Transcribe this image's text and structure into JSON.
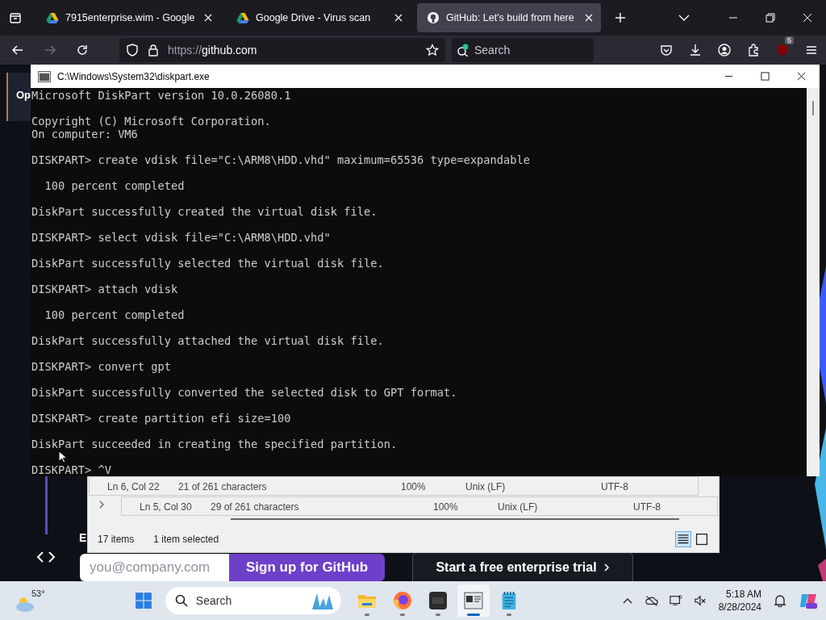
{
  "browser": {
    "tabs": [
      {
        "title": "7915enterprise.wim - Google",
        "kind": "drive",
        "selected": false
      },
      {
        "title": "Google Drive - Virus scan",
        "kind": "drive",
        "selected": false
      },
      {
        "title": "GitHub: Let's build from here",
        "kind": "github",
        "selected": true
      }
    ],
    "back_disabled": false,
    "forward_disabled": true,
    "url": {
      "scheme": "https://",
      "host": "github.com"
    },
    "search": {
      "placeholder": "Search"
    },
    "extension_badge": "5"
  },
  "console": {
    "title": "C:\\Windows\\System32\\diskpart.exe",
    "paragraphs": [
      [
        "Microsoft DiskPart version 10.0.26080.1"
      ],
      [
        "Copyright (C) Microsoft Corporation.",
        "On computer: VM6"
      ],
      [
        "DISKPART> create vdisk file=\"C:\\ARM8\\HDD.vhd\" maximum=65536 type=expandable"
      ],
      [
        "  100 percent completed"
      ],
      [
        "DiskPart successfully created the virtual disk file."
      ],
      [
        "DISKPART> select vdisk file=\"C:\\ARM8\\HDD.vhd\""
      ],
      [
        "DiskPart successfully selected the virtual disk file."
      ],
      [
        "DISKPART> attach vdisk"
      ],
      [
        "  100 percent completed"
      ],
      [
        "DiskPart successfully attached the virtual disk file."
      ],
      [
        "DISKPART> convert gpt"
      ],
      [
        "DiskPart successfully converted the selected disk to GPT format."
      ],
      [
        "DISKPART> create partition efi size=100"
      ],
      [
        "DiskPart succeeded in creating the specified partition."
      ],
      [
        "DISKPART> ^V"
      ]
    ]
  },
  "notepads": [
    {
      "position": "Ln 6, Col 22",
      "characters": "21 of 261 characters",
      "zoom": "100%",
      "line_ending": "Unix (LF)",
      "encoding": "UTF-8"
    },
    {
      "position": "Ln 5, Col 30",
      "characters": "29 of 261 characters",
      "zoom": "100%",
      "line_ending": "Unix (LF)",
      "encoding": "UTF-8"
    }
  ],
  "explorer": {
    "item_count": "17 items",
    "selection": "1 item selected"
  },
  "page": {
    "card_texts": [
      "Op"
    ],
    "side_letter": "E",
    "email_placeholder": "you@company.com",
    "signup_button": "Sign up for GitHub",
    "enterprise_button": "Start a free enterprise trial"
  },
  "taskbar": {
    "temperature": "53°",
    "search_placeholder": "Search",
    "apps": [
      {
        "kind": "folder",
        "selected": false
      },
      {
        "kind": "firefox",
        "selected": false
      },
      {
        "kind": "dark",
        "selected": false
      },
      {
        "kind": "console",
        "selected": true
      },
      {
        "kind": "notepad",
        "selected": false
      }
    ],
    "time": "5:18 AM",
    "date": "8/28/2024"
  }
}
